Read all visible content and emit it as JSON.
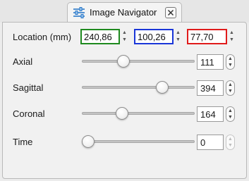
{
  "tab": {
    "title": "Image Navigator",
    "icon": "sliders-icon",
    "close_icon": "close-icon"
  },
  "location": {
    "label": "Location (mm)",
    "x": "240,86",
    "y": "100,26",
    "z": "77,70",
    "colors": {
      "x": "#1f8a1f",
      "y": "#1a36d8",
      "z": "#e01b1b"
    }
  },
  "sliders": [
    {
      "label": "Axial",
      "value": "111",
      "level": 0.35,
      "enabled": true
    },
    {
      "label": "Sagittal",
      "value": "394",
      "level": 0.74,
      "enabled": true
    },
    {
      "label": "Coronal",
      "value": "164",
      "level": 0.34,
      "enabled": true
    },
    {
      "label": "Time",
      "value": "0",
      "level": 0.0,
      "enabled": false
    }
  ]
}
